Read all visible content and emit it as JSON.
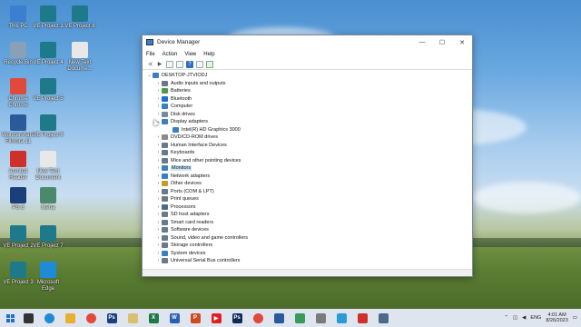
{
  "desktop": {
    "icons": [
      {
        "label": "This PC",
        "icon": "monitor-icon",
        "color": "#3b7fd0"
      },
      {
        "label": "VE Project 1",
        "icon": "video-project-icon",
        "color": "#1e7a8a"
      },
      {
        "label": "VE Project 8",
        "icon": "video-project-icon",
        "color": "#1e7a8a"
      },
      {
        "label": "Recycle Bin",
        "icon": "recycle-bin-icon",
        "color": "#8aa0b8"
      },
      {
        "label": "VE Project 4",
        "icon": "video-project-icon",
        "color": "#1e7a8a"
      },
      {
        "label": "New Text Docume...",
        "icon": "text-document-icon",
        "color": "#e8e8e8"
      },
      {
        "label": "Chrome Chrome",
        "icon": "chrome-icon",
        "color": "#e04a3a"
      },
      {
        "label": "VE Project 5",
        "icon": "video-project-icon",
        "color": "#1e7a8a"
      },
      {
        "label": "Wondershare Filmora 11",
        "icon": "filmora-icon",
        "color": "#2a5a9a"
      },
      {
        "label": "VE Project 6",
        "icon": "video-project-icon",
        "color": "#1e7a8a"
      },
      {
        "label": "Acrobat Reader",
        "icon": "pdf-icon",
        "color": "#d0302a"
      },
      {
        "label": "New Text Document",
        "icon": "text-document-icon",
        "color": "#e8e8e8"
      },
      {
        "label": "PS 8",
        "icon": "photoshop-icon",
        "color": "#1b3f7a"
      },
      {
        "label": "Meha",
        "icon": "image-file-icon",
        "color": "#4a8a6a"
      },
      {
        "label": "VE Project 2",
        "icon": "video-project-icon",
        "color": "#1e7a8a"
      },
      {
        "label": "VE Project 7",
        "icon": "video-project-icon",
        "color": "#1e7a8a"
      },
      {
        "label": "VE Project 3",
        "icon": "video-project-icon",
        "color": "#1e7a8a"
      },
      {
        "label": "Microsoft Edge",
        "icon": "edge-icon",
        "color": "#1f8ad6"
      }
    ]
  },
  "window": {
    "title": "Device Manager",
    "minimize": "—",
    "maximize": "☐",
    "close": "✕",
    "menu": [
      "File",
      "Action",
      "View",
      "Help"
    ],
    "computer_name": "DESKTOP-JTVIODJ",
    "tree": [
      {
        "label": "Audio inputs and outputs",
        "icon": "speaker-icon",
        "color": "#6a7a8a",
        "expanded": false,
        "selected": false,
        "level": 1
      },
      {
        "label": "Batteries",
        "icon": "battery-icon",
        "color": "#4a9a4a",
        "expanded": false,
        "selected": false,
        "level": 1
      },
      {
        "label": "Bluetooth",
        "icon": "bluetooth-icon",
        "color": "#1f6fd0",
        "expanded": false,
        "selected": false,
        "level": 1
      },
      {
        "label": "Computer",
        "icon": "computer-icon",
        "color": "#3a7fc4",
        "expanded": false,
        "selected": false,
        "level": 1
      },
      {
        "label": "Disk drives",
        "icon": "disk-icon",
        "color": "#7a8a9a",
        "expanded": false,
        "selected": false,
        "level": 1
      },
      {
        "label": "Display adapters",
        "icon": "display-adapter-icon",
        "color": "#3a7fc4",
        "expanded": true,
        "selected": false,
        "level": 1
      },
      {
        "label": "Intel(R) HD Graphics 3000",
        "icon": "display-adapter-icon",
        "color": "#3a7fc4",
        "expanded": null,
        "selected": false,
        "level": 2
      },
      {
        "label": "DVD/CD-ROM drives",
        "icon": "dvd-icon",
        "color": "#8a8a8a",
        "expanded": false,
        "selected": false,
        "level": 1
      },
      {
        "label": "Human Interface Devices",
        "icon": "hid-icon",
        "color": "#6a7a8a",
        "expanded": false,
        "selected": false,
        "level": 1
      },
      {
        "label": "Keyboards",
        "icon": "keyboard-icon",
        "color": "#6a7a8a",
        "expanded": false,
        "selected": false,
        "level": 1
      },
      {
        "label": "Mice and other pointing devices",
        "icon": "mouse-icon",
        "color": "#6a7a8a",
        "expanded": false,
        "selected": false,
        "level": 1
      },
      {
        "label": "Monitors",
        "icon": "monitor-icon",
        "color": "#3a7fc4",
        "expanded": false,
        "selected": true,
        "level": 1
      },
      {
        "label": "Network adapters",
        "icon": "network-icon",
        "color": "#3a7fc4",
        "expanded": false,
        "selected": false,
        "level": 1
      },
      {
        "label": "Other devices",
        "icon": "unknown-device-icon",
        "color": "#c89a2a",
        "expanded": false,
        "selected": false,
        "level": 1
      },
      {
        "label": "Ports (COM & LPT)",
        "icon": "port-icon",
        "color": "#6a7a8a",
        "expanded": false,
        "selected": false,
        "level": 1
      },
      {
        "label": "Print queues",
        "icon": "printer-icon",
        "color": "#6a7a8a",
        "expanded": false,
        "selected": false,
        "level": 1
      },
      {
        "label": "Processors",
        "icon": "processor-icon",
        "color": "#4a6a8a",
        "expanded": false,
        "selected": false,
        "level": 1
      },
      {
        "label": "SD host adapters",
        "icon": "sd-card-icon",
        "color": "#6a7a8a",
        "expanded": false,
        "selected": false,
        "level": 1
      },
      {
        "label": "Smart card readers",
        "icon": "smart-card-icon",
        "color": "#6a7a8a",
        "expanded": false,
        "selected": false,
        "level": 1
      },
      {
        "label": "Software devices",
        "icon": "software-device-icon",
        "color": "#6a7a8a",
        "expanded": false,
        "selected": false,
        "level": 1
      },
      {
        "label": "Sound, video and game controllers",
        "icon": "speaker-icon",
        "color": "#6a7a8a",
        "expanded": false,
        "selected": false,
        "level": 1
      },
      {
        "label": "Storage controllers",
        "icon": "storage-icon",
        "color": "#6a7a8a",
        "expanded": false,
        "selected": false,
        "level": 1
      },
      {
        "label": "System devices",
        "icon": "system-device-icon",
        "color": "#3a7fc4",
        "expanded": false,
        "selected": false,
        "level": 1
      },
      {
        "label": "Universal Serial Bus controllers",
        "icon": "usb-icon",
        "color": "#6a7a8a",
        "expanded": false,
        "selected": false,
        "level": 1
      }
    ]
  },
  "taskbar": {
    "apps": [
      {
        "icon": "task-view-icon",
        "color": "#333333",
        "text": ""
      },
      {
        "icon": "edge-icon",
        "color": "#1f8ad6",
        "text": ""
      },
      {
        "icon": "file-explorer-icon",
        "color": "#e8b030",
        "text": ""
      },
      {
        "icon": "chrome-icon",
        "color": "#e04a3a",
        "text": ""
      },
      {
        "icon": "photoshop-icon",
        "color": "#1b3f7a",
        "text": "Ps"
      },
      {
        "icon": "notes-icon",
        "color": "#d8c070",
        "text": ""
      },
      {
        "icon": "excel-icon",
        "color": "#1e7a45",
        "text": "X"
      },
      {
        "icon": "word-icon",
        "color": "#2b5fb0",
        "text": "W"
      },
      {
        "icon": "powerpoint-icon",
        "color": "#d04a20",
        "text": "P"
      },
      {
        "icon": "youtube-icon",
        "color": "#e02020",
        "text": "▶"
      },
      {
        "icon": "photoshop-icon",
        "color": "#0f2a55",
        "text": "Ps"
      },
      {
        "icon": "chrome-icon",
        "color": "#e04a3a",
        "text": ""
      },
      {
        "icon": "filmora-icon",
        "color": "#2a5a9a",
        "text": ""
      },
      {
        "icon": "app-icon",
        "color": "#3a9a5a",
        "text": ""
      },
      {
        "icon": "app-icon",
        "color": "#7a7a7a",
        "text": ""
      },
      {
        "icon": "telegram-icon",
        "color": "#2a9ad8",
        "text": ""
      },
      {
        "icon": "pdf-icon",
        "color": "#d0302a",
        "text": ""
      },
      {
        "icon": "device-manager-icon",
        "color": "#4a6a8a",
        "text": ""
      }
    ],
    "language": "ENG",
    "time": "4:01 AM",
    "date": "8/26/2023"
  }
}
